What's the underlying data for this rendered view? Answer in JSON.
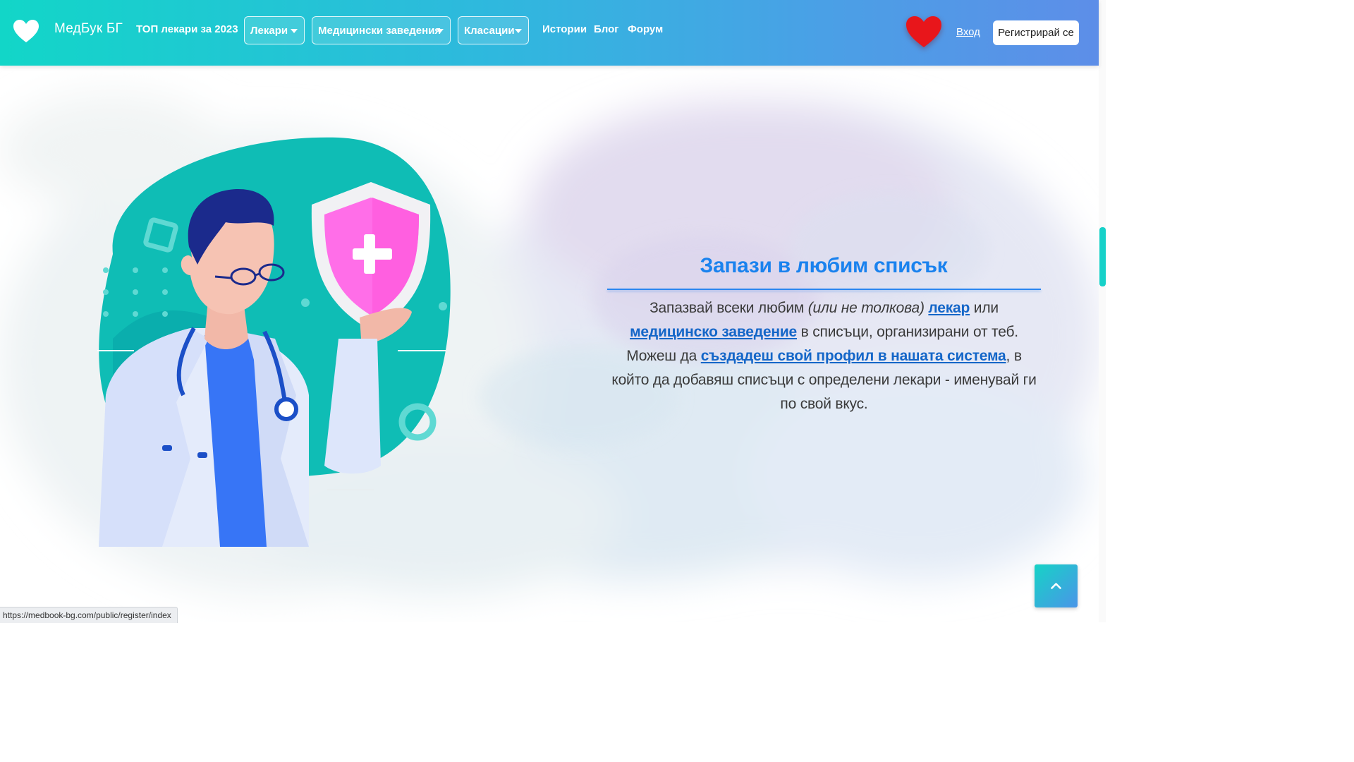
{
  "navbar": {
    "brand": "МедБук БГ",
    "top_doctors": "ТОП лекари за 2023",
    "dropdowns": [
      "Лекари",
      "Медицински заведения",
      "Класации"
    ],
    "links": [
      "Истории",
      "Блог",
      "Форум"
    ],
    "login": "Вход",
    "register": "Регистрирай се",
    "colors": {
      "gradient_start": "#12d6c8",
      "gradient_end": "#5d8ee8",
      "heart": "#e8161b"
    }
  },
  "feature": {
    "title": "Запази в любим списък",
    "text_1": "Запазвай всеки любим ",
    "text_italic": "(или не толкова)",
    "link_doctor": "лекар",
    "text_or": " или ",
    "link_facility": "медицинско заведение",
    "text_2": " в списъци, организирани от теб. Можеш да ",
    "link_profile": "създадеш свой профил в нашата система",
    "text_3": ", в който да добавяш списъци с определени лекари - именувай ги по свой вкус.",
    "title_color": "#1a82ee"
  },
  "icons": {
    "brand": "heart-icon",
    "favorites": "heart-icon",
    "back_to_top": "chevron-up-icon"
  },
  "status_bar": {
    "url": "https://medbook-bg.com/public/register/index"
  }
}
